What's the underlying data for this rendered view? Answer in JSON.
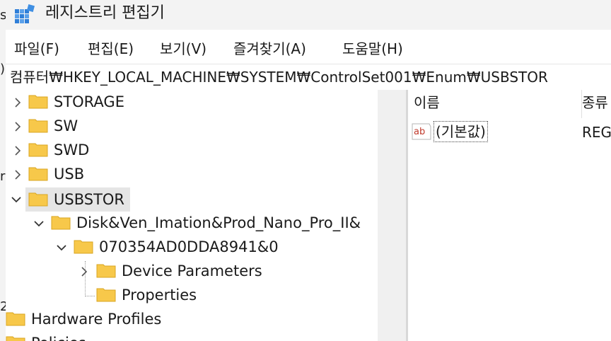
{
  "window": {
    "title": "레지스트리 편집기"
  },
  "behind_window": {
    "glyphs": [
      "s",
      ")",
      "r",
      "2"
    ]
  },
  "menu": [
    {
      "label": "파일(F)"
    },
    {
      "label": "편집(E)"
    },
    {
      "label": "보기(V)"
    },
    {
      "label": "즐겨찾기(A)"
    },
    {
      "label": "도움말(H)"
    }
  ],
  "address": {
    "path": "컴퓨터₩HKEY_LOCAL_MACHINE₩SYSTEM₩ControlSet001₩Enum₩USBSTOR"
  },
  "tree": {
    "items": [
      {
        "label": "STORAGE",
        "expander": "collapsed"
      },
      {
        "label": "SW",
        "expander": "collapsed"
      },
      {
        "label": "SWD",
        "expander": "collapsed"
      },
      {
        "label": "USB",
        "expander": "collapsed"
      },
      {
        "label": "USBSTOR",
        "expander": "expanded",
        "selected": true
      },
      {
        "label": "Disk&Ven_Imation&Prod_Nano_Pro_II&",
        "expander": "expanded"
      },
      {
        "label": "070354AD0DDA8941&0",
        "expander": "expanded"
      },
      {
        "label": "Device Parameters",
        "expander": "collapsed"
      },
      {
        "label": "Properties",
        "expander": "none"
      },
      {
        "label": "Hardware Profiles",
        "expander": "none"
      },
      {
        "label": "Policies",
        "expander": "none"
      }
    ]
  },
  "list": {
    "columns": [
      {
        "label": "이름"
      },
      {
        "label": "종류"
      }
    ],
    "rows": [
      {
        "name": "(기본값)",
        "type": "REG_SZ",
        "icon": "string-value-icon",
        "icon_text": "ab"
      }
    ]
  },
  "colors": {
    "folder": "#f7c84a",
    "folder_edge": "#d9a621",
    "selection": "#e5e5e5",
    "value_icon": "#c0392b"
  }
}
